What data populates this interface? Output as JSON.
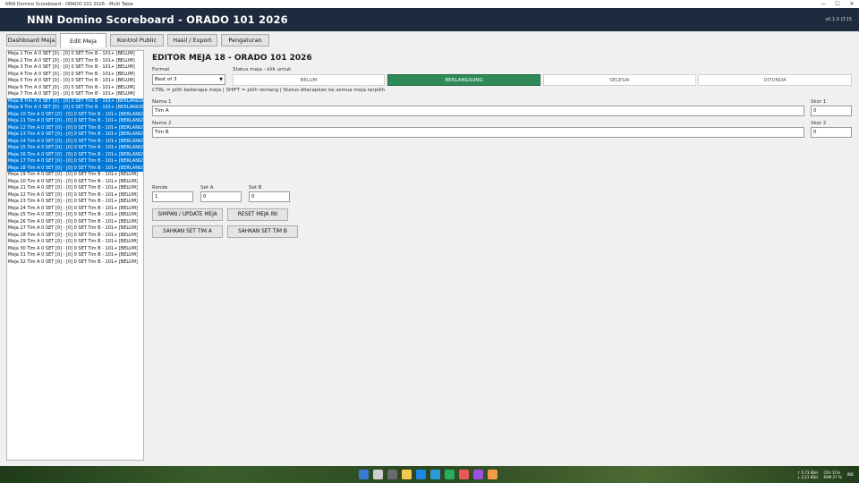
{
  "window": {
    "title": "NNN Domino Scoreboard - ORADO 101 2026 - Multi Table",
    "controls": [
      "—",
      "☐",
      "✕"
    ]
  },
  "header": {
    "title": "NNN Domino Scoreboard - ORADO 101 2026",
    "version": "v0.1.0 LT.15"
  },
  "tabs": [
    "Dashboard Meja",
    "Edit Meja",
    "Kontrol Public",
    "Hasil / Export",
    "Pengaturan"
  ],
  "active_tab": 1,
  "tables": [
    {
      "text": "Meja 1   Tim A  0 SET  [0]  -  [0]  0 SET  Tim B  -  101+  [BELUM]",
      "selected": false
    },
    {
      "text": "Meja 2   Tim A  0 SET  [0]  -  [0]  0 SET  Tim B  -  101+  [BELUM]",
      "selected": false
    },
    {
      "text": "Meja 3   Tim A  0 SET  [0]  -  [0]  0 SET  Tim B  -  101+  [BELUM]",
      "selected": false
    },
    {
      "text": "Meja 4   Tim A  0 SET  [0]  -  [0]  0 SET  Tim B  -  101+  [BELUM]",
      "selected": false
    },
    {
      "text": "Meja 5   Tim A  0 SET  [0]  -  [0]  0 SET  Tim B  -  101+  [BELUM]",
      "selected": false
    },
    {
      "text": "Meja 6   Tim A  0 SET  [0]  -  [0]  0 SET  Tim B  -  101+  [BELUM]",
      "selected": false
    },
    {
      "text": "Meja 7   Tim A  0 SET  [0]  -  [0]  0 SET  Tim B  -  101+  [BELUM]",
      "selected": false
    },
    {
      "text": "Meja 8   Tim A  0 SET  [0]  -  [0]  0 SET  Tim B  -  101+  [BERLANGSUNG]",
      "selected": true
    },
    {
      "text": "Meja 9   Tim A  0 SET  [0]  -  [0]  0 SET  Tim B  -  101+  [BERLANGSUNG]",
      "selected": true
    },
    {
      "text": "Meja 10  Tim A  0 SET  [0]  -  [0]  0 SET  Tim B  -  101+  [BERLANGSUNG]",
      "selected": true
    },
    {
      "text": "Meja 11  Tim A  0 SET  [0]  -  [0]  0 SET  Tim B  -  101+  [BERLANGSUNG]",
      "selected": true
    },
    {
      "text": "Meja 12  Tim A  0 SET  [0]  -  [0]  0 SET  Tim B  -  101+  [BERLANGSUNG]",
      "selected": true
    },
    {
      "text": "Meja 13  Tim A  0 SET  [0]  -  [0]  0 SET  Tim B  -  101+  [BERLANGSUNG]",
      "selected": true
    },
    {
      "text": "Meja 14  Tim A  0 SET  [0]  -  [0]  0 SET  Tim B  -  101+  [BERLANGSUNG]",
      "selected": true
    },
    {
      "text": "Meja 15  Tim A  0 SET  [0]  -  [0]  0 SET  Tim B  -  101+  [BERLANGSUNG]",
      "selected": true
    },
    {
      "text": "Meja 16  Tim A  0 SET  [0]  -  [0]  0 SET  Tim B  -  101+  [BERLANGSUNG]",
      "selected": true
    },
    {
      "text": "Meja 17  Tim A  0 SET  [0]  -  [0]  0 SET  Tim B  -  101+  [BERLANGSUNG]",
      "selected": true
    },
    {
      "text": "Meja 18  Tim A  0 SET  [0]  -  [0]  0 SET  Tim B  -  101+  [BERLANGSUNG]",
      "selected": true
    },
    {
      "text": "Meja 19  Tim A  0 SET  [0]  -  [0]  0 SET  Tim B  -  101+  [BELUM]",
      "selected": false
    },
    {
      "text": "Meja 20  Tim A  0 SET  [0]  -  [0]  0 SET  Tim B  -  101+  [BELUM]",
      "selected": false
    },
    {
      "text": "Meja 21  Tim A  0 SET  [0]  -  [0]  0 SET  Tim B  -  101+  [BELUM]",
      "selected": false
    },
    {
      "text": "Meja 22  Tim A  0 SET  [0]  -  [0]  0 SET  Tim B  -  101+  [BELUM]",
      "selected": false
    },
    {
      "text": "Meja 23  Tim A  0 SET  [0]  -  [0]  0 SET  Tim B  -  101+  [BELUM]",
      "selected": false
    },
    {
      "text": "Meja 24  Tim A  0 SET  [0]  -  [0]  0 SET  Tim B  -  101+  [BELUM]",
      "selected": false
    },
    {
      "text": "Meja 25  Tim A  0 SET  [0]  -  [0]  0 SET  Tim B  -  101+  [BELUM]",
      "selected": false
    },
    {
      "text": "Meja 26  Tim A  0 SET  [0]  -  [0]  0 SET  Tim B  -  101+  [BELUM]",
      "selected": false
    },
    {
      "text": "Meja 27  Tim A  0 SET  [0]  -  [0]  0 SET  Tim B  -  101+  [BELUM]",
      "selected": false
    },
    {
      "text": "Meja 28  Tim A  0 SET  [0]  -  [0]  0 SET  Tim B  -  101+  [BELUM]",
      "selected": false
    },
    {
      "text": "Meja 29  Tim A  0 SET  [0]  -  [0]  0 SET  Tim B  -  101+  [BELUM]",
      "selected": false
    },
    {
      "text": "Meja 30  Tim A  0 SET  [0]  -  [0]  0 SET  Tim B  -  101+  [BELUM]",
      "selected": false
    },
    {
      "text": "Meja 31  Tim A  0 SET  [0]  -  [0]  0 SET  Tim B  -  101+  [BELUM]",
      "selected": false
    },
    {
      "text": "Meja 32  Tim A  0 SET  [0]  -  [0]  0 SET  Tim B  -  101+  [BELUM]",
      "selected": false
    }
  ],
  "editor": {
    "title": "EDITOR MEJA 18 - ORADO 101 2026",
    "format_label": "Format",
    "format_value": "Best of 3",
    "status_label": "Status meja - klik untuk",
    "statuses": [
      "BELUM",
      "BERLANGSUNG",
      "SELESAI",
      "DITUNDA"
    ],
    "active_status": 1,
    "hint": "CTRL = pilih beberapa meja | SHIFT = pilih rentang | Status diterapkan ke semua meja terpilih",
    "nama1_label": "Nama 1",
    "nama1_value": "Tim A",
    "skor1_label": "Skor 1",
    "skor1_value": "0",
    "nama2_label": "Nama 2",
    "nama2_value": "Tim B",
    "skor2_label": "Skor 2",
    "skor2_value": "0",
    "ronde_label": "Ronde",
    "ronde_value": "1",
    "seta_label": "Set A",
    "seta_value": "0",
    "setb_label": "Set B",
    "setb_value": "0",
    "btn_save": "SIMPAN / UPDATE MEJA",
    "btn_reset": "RESET MEJA INI",
    "btn_set_a": "SAHKAN SET TIM A",
    "btn_set_b": "SAHKAN SET TIM B"
  },
  "taskbar": {
    "net_up": "↑ 5,73 KB/s",
    "net_down": "↓ 2,21 KB/s",
    "cpu": "CPU 11%",
    "ram": "RAM 27 %",
    "lang": "IND",
    "colors": {
      "accent": "#0078d7",
      "active_status": "#2e8b57",
      "header": "#1e2a3e"
    }
  }
}
